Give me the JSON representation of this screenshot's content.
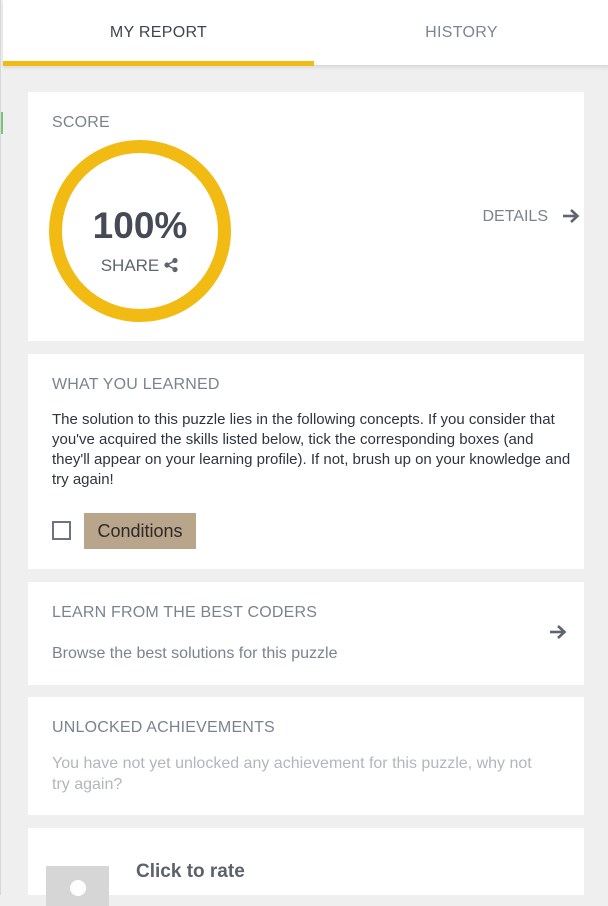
{
  "tabs": [
    {
      "label": "MY REPORT",
      "active": true
    },
    {
      "label": "HISTORY",
      "active": false
    }
  ],
  "accent_color": "#f2bb13",
  "score": {
    "title": "SCORE",
    "value": "100%",
    "share_label": "SHARE",
    "details_label": "DETAILS",
    "progress": 1.0
  },
  "learned": {
    "title": "WHAT YOU LEARNED",
    "text": "The solution to this puzzle lies in the following concepts. If you consider that you've acquired the skills listed below, tick the corresponding boxes (and they'll appear on your learning profile). If not, brush up on your knowledge and try again!",
    "concepts": [
      {
        "label": "Conditions",
        "checked": false
      }
    ]
  },
  "best_coders": {
    "title": "LEARN FROM THE BEST CODERS",
    "subtitle": "Browse the best solutions for this puzzle"
  },
  "achievements": {
    "title": "UNLOCKED ACHIEVEMENTS",
    "text": "You have not yet unlocked any achievement for this puzzle, why not try again?"
  },
  "rating": {
    "title": "Click to rate"
  },
  "icons": {
    "share": "share-icon",
    "arrow": "arrow-right-icon",
    "avatar": "avatar-placeholder-icon"
  }
}
